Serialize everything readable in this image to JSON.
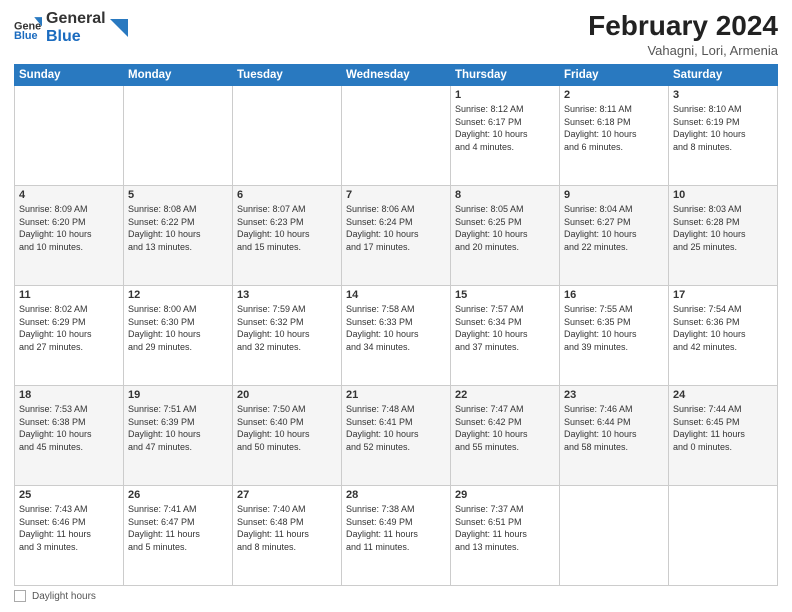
{
  "header": {
    "logo_line1": "General",
    "logo_line2": "Blue",
    "month_year": "February 2024",
    "location": "Vahagni, Lori, Armenia"
  },
  "weekdays": [
    "Sunday",
    "Monday",
    "Tuesday",
    "Wednesday",
    "Thursday",
    "Friday",
    "Saturday"
  ],
  "weeks": [
    [
      {
        "day": "",
        "info": ""
      },
      {
        "day": "",
        "info": ""
      },
      {
        "day": "",
        "info": ""
      },
      {
        "day": "",
        "info": ""
      },
      {
        "day": "1",
        "info": "Sunrise: 8:12 AM\nSunset: 6:17 PM\nDaylight: 10 hours\nand 4 minutes."
      },
      {
        "day": "2",
        "info": "Sunrise: 8:11 AM\nSunset: 6:18 PM\nDaylight: 10 hours\nand 6 minutes."
      },
      {
        "day": "3",
        "info": "Sunrise: 8:10 AM\nSunset: 6:19 PM\nDaylight: 10 hours\nand 8 minutes."
      }
    ],
    [
      {
        "day": "4",
        "info": "Sunrise: 8:09 AM\nSunset: 6:20 PM\nDaylight: 10 hours\nand 10 minutes."
      },
      {
        "day": "5",
        "info": "Sunrise: 8:08 AM\nSunset: 6:22 PM\nDaylight: 10 hours\nand 13 minutes."
      },
      {
        "day": "6",
        "info": "Sunrise: 8:07 AM\nSunset: 6:23 PM\nDaylight: 10 hours\nand 15 minutes."
      },
      {
        "day": "7",
        "info": "Sunrise: 8:06 AM\nSunset: 6:24 PM\nDaylight: 10 hours\nand 17 minutes."
      },
      {
        "day": "8",
        "info": "Sunrise: 8:05 AM\nSunset: 6:25 PM\nDaylight: 10 hours\nand 20 minutes."
      },
      {
        "day": "9",
        "info": "Sunrise: 8:04 AM\nSunset: 6:27 PM\nDaylight: 10 hours\nand 22 minutes."
      },
      {
        "day": "10",
        "info": "Sunrise: 8:03 AM\nSunset: 6:28 PM\nDaylight: 10 hours\nand 25 minutes."
      }
    ],
    [
      {
        "day": "11",
        "info": "Sunrise: 8:02 AM\nSunset: 6:29 PM\nDaylight: 10 hours\nand 27 minutes."
      },
      {
        "day": "12",
        "info": "Sunrise: 8:00 AM\nSunset: 6:30 PM\nDaylight: 10 hours\nand 29 minutes."
      },
      {
        "day": "13",
        "info": "Sunrise: 7:59 AM\nSunset: 6:32 PM\nDaylight: 10 hours\nand 32 minutes."
      },
      {
        "day": "14",
        "info": "Sunrise: 7:58 AM\nSunset: 6:33 PM\nDaylight: 10 hours\nand 34 minutes."
      },
      {
        "day": "15",
        "info": "Sunrise: 7:57 AM\nSunset: 6:34 PM\nDaylight: 10 hours\nand 37 minutes."
      },
      {
        "day": "16",
        "info": "Sunrise: 7:55 AM\nSunset: 6:35 PM\nDaylight: 10 hours\nand 39 minutes."
      },
      {
        "day": "17",
        "info": "Sunrise: 7:54 AM\nSunset: 6:36 PM\nDaylight: 10 hours\nand 42 minutes."
      }
    ],
    [
      {
        "day": "18",
        "info": "Sunrise: 7:53 AM\nSunset: 6:38 PM\nDaylight: 10 hours\nand 45 minutes."
      },
      {
        "day": "19",
        "info": "Sunrise: 7:51 AM\nSunset: 6:39 PM\nDaylight: 10 hours\nand 47 minutes."
      },
      {
        "day": "20",
        "info": "Sunrise: 7:50 AM\nSunset: 6:40 PM\nDaylight: 10 hours\nand 50 minutes."
      },
      {
        "day": "21",
        "info": "Sunrise: 7:48 AM\nSunset: 6:41 PM\nDaylight: 10 hours\nand 52 minutes."
      },
      {
        "day": "22",
        "info": "Sunrise: 7:47 AM\nSunset: 6:42 PM\nDaylight: 10 hours\nand 55 minutes."
      },
      {
        "day": "23",
        "info": "Sunrise: 7:46 AM\nSunset: 6:44 PM\nDaylight: 10 hours\nand 58 minutes."
      },
      {
        "day": "24",
        "info": "Sunrise: 7:44 AM\nSunset: 6:45 PM\nDaylight: 11 hours\nand 0 minutes."
      }
    ],
    [
      {
        "day": "25",
        "info": "Sunrise: 7:43 AM\nSunset: 6:46 PM\nDaylight: 11 hours\nand 3 minutes."
      },
      {
        "day": "26",
        "info": "Sunrise: 7:41 AM\nSunset: 6:47 PM\nDaylight: 11 hours\nand 5 minutes."
      },
      {
        "day": "27",
        "info": "Sunrise: 7:40 AM\nSunset: 6:48 PM\nDaylight: 11 hours\nand 8 minutes."
      },
      {
        "day": "28",
        "info": "Sunrise: 7:38 AM\nSunset: 6:49 PM\nDaylight: 11 hours\nand 11 minutes."
      },
      {
        "day": "29",
        "info": "Sunrise: 7:37 AM\nSunset: 6:51 PM\nDaylight: 11 hours\nand 13 minutes."
      },
      {
        "day": "",
        "info": ""
      },
      {
        "day": "",
        "info": ""
      }
    ]
  ],
  "footer": {
    "daylight_label": "Daylight hours"
  }
}
